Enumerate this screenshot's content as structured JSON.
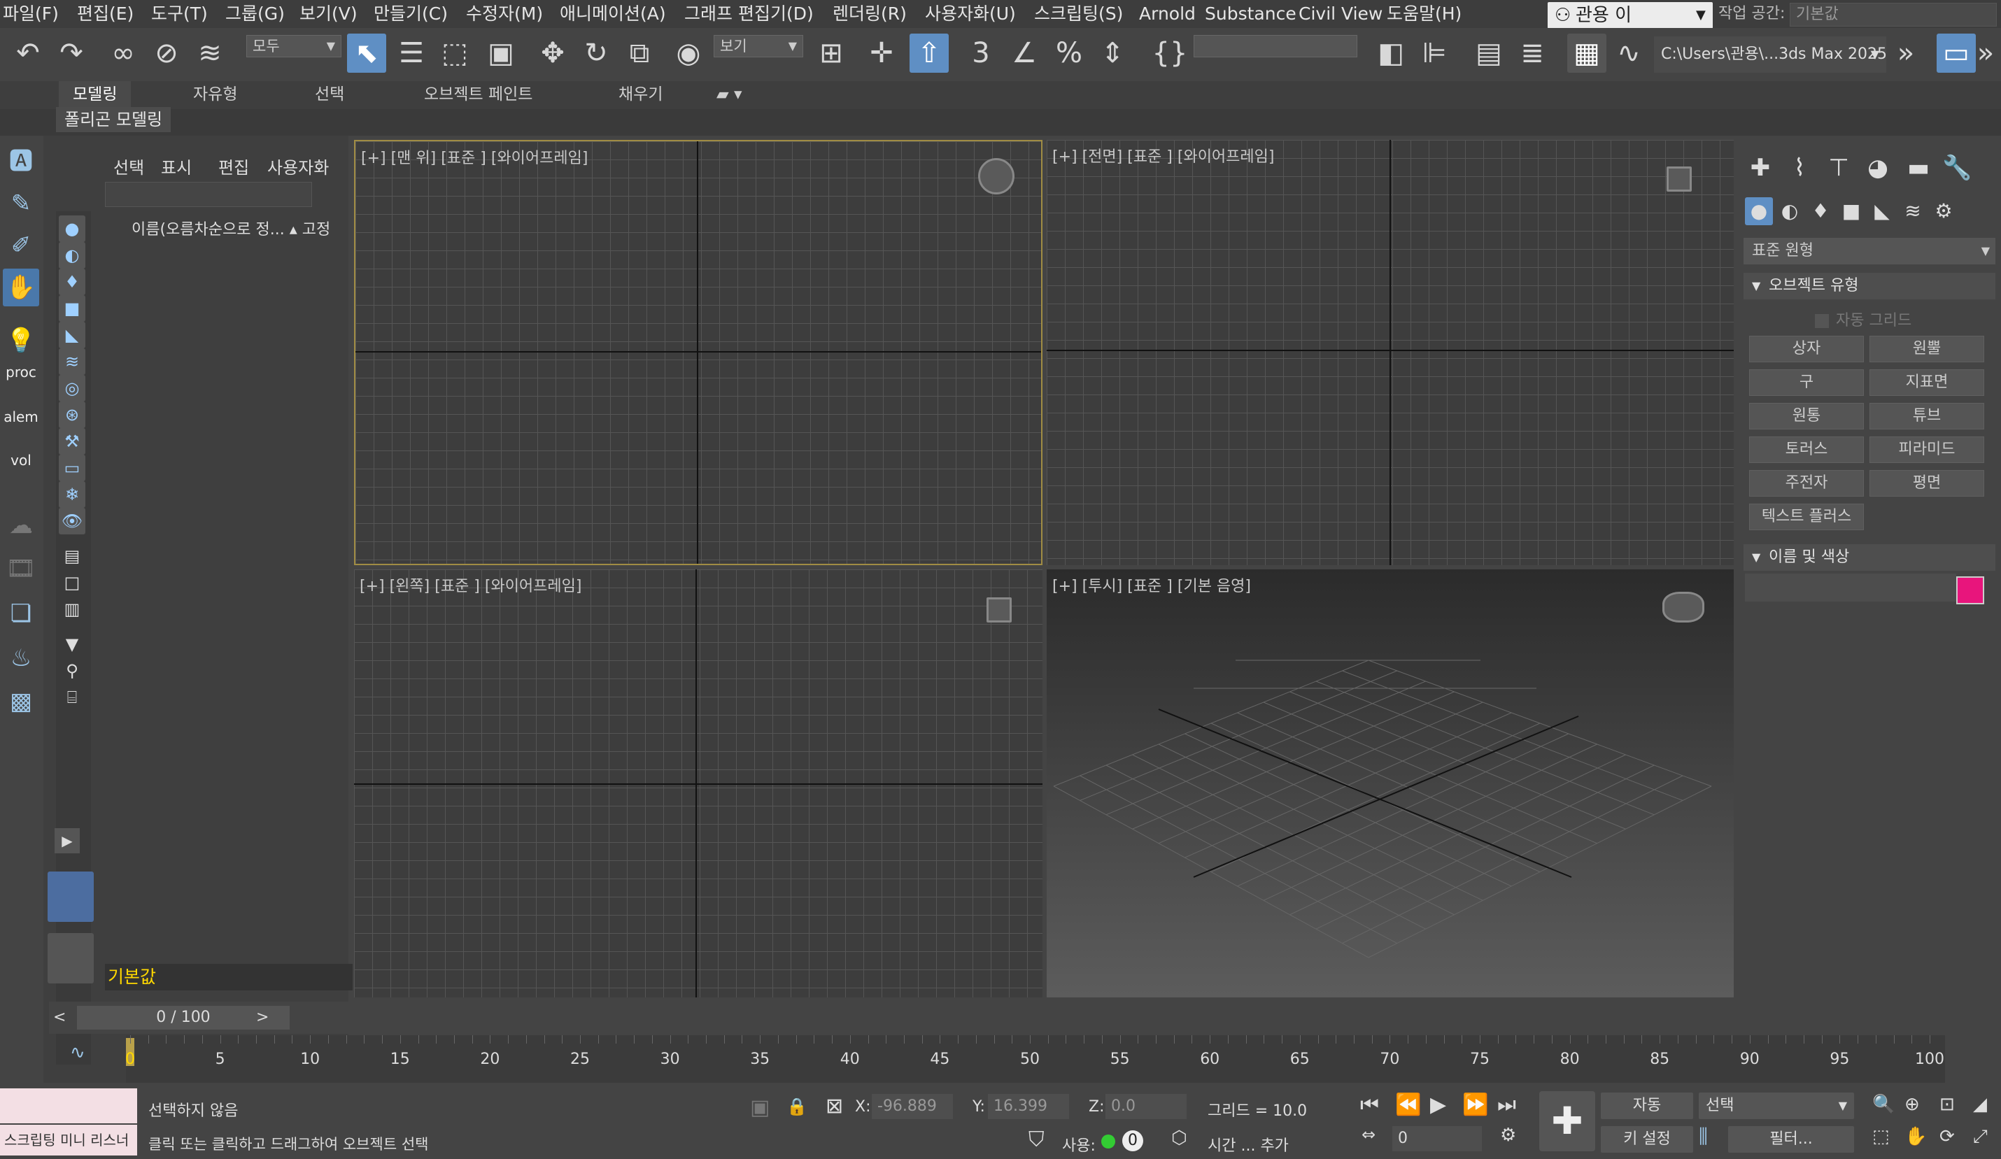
{
  "menu": [
    "파일(F)",
    "편집(E)",
    "도구(T)",
    "그룹(G)",
    "보기(V)",
    "만들기(C)",
    "수정자(M)",
    "애니메이션(A)",
    "그래프 편집기(D)",
    "렌더링(R)",
    "사용자화(U)",
    "스크립팅(S)",
    "Arnold",
    "Substance",
    "Civil View",
    "도움말(H)"
  ],
  "user": {
    "name": "관용 이"
  },
  "workspace": {
    "label": "작업 공간:",
    "value": "기본값"
  },
  "toolbar": {
    "selection_filter": "모두",
    "ref_coord": "보기",
    "named_sel": "",
    "path": "C:\\Users\\관용\\...3ds Max 2025"
  },
  "ribbon": {
    "tabs": [
      "모델링",
      "자유형",
      "선택",
      "오브젝트 페인트",
      "채우기"
    ],
    "sub": "폴리곤 모델링"
  },
  "left_strip": [
    "proc",
    "alem",
    "vol"
  ],
  "scene_explorer": {
    "menu": [
      "선택",
      "표시",
      "편집",
      "사용자화"
    ],
    "column": "이름(오름차순으로 정...",
    "pin": "고정",
    "layer": "기본값"
  },
  "viewports": {
    "top": "[+] [맨 위] [표준 ] [와이어프레임]",
    "front": "[+] [전면] [표준 ] [와이어프레임]",
    "left": "[+] [왼쪽] [표준 ] [와이어프레임]",
    "persp": "[+] [투시] [표준 ] [기본 음영]"
  },
  "command_panel": {
    "dropdown": "표준 원형",
    "section_object": "오브젝트 유형",
    "auto_grid": "자동 그리드",
    "buttons": [
      "상자",
      "원뿔",
      "구",
      "지표면",
      "원통",
      "튜브",
      "토러스",
      "피라미드",
      "주전자",
      "평면",
      "텍스트 플러스"
    ],
    "section_name": "이름 및 색상",
    "color": "#E8157C"
  },
  "timeline": {
    "slider": "0 / 100",
    "ticks": [
      "0",
      "5",
      "10",
      "15",
      "20",
      "25",
      "30",
      "35",
      "40",
      "45",
      "50",
      "55",
      "60",
      "65",
      "70",
      "75",
      "80",
      "85",
      "90",
      "95",
      "100"
    ]
  },
  "status": {
    "mini": "스크립팅 미니 리스너",
    "line1": "선택하지 않음",
    "line2": "클릭 또는 클릭하고 드래그하여 오브젝트 선택",
    "x_label": "X:",
    "x": "-96.889",
    "y_label": "Y:",
    "y": "16.399",
    "z_label": "Z:",
    "z": "0.0",
    "grid": "그리드 = 10.0",
    "use_label": "사용:",
    "use_count": "0",
    "time_add": "시간 ... 추가",
    "auto": "자동",
    "select": "선택",
    "key_set": "키 설정",
    "filter": "필터...",
    "frame": "0"
  }
}
